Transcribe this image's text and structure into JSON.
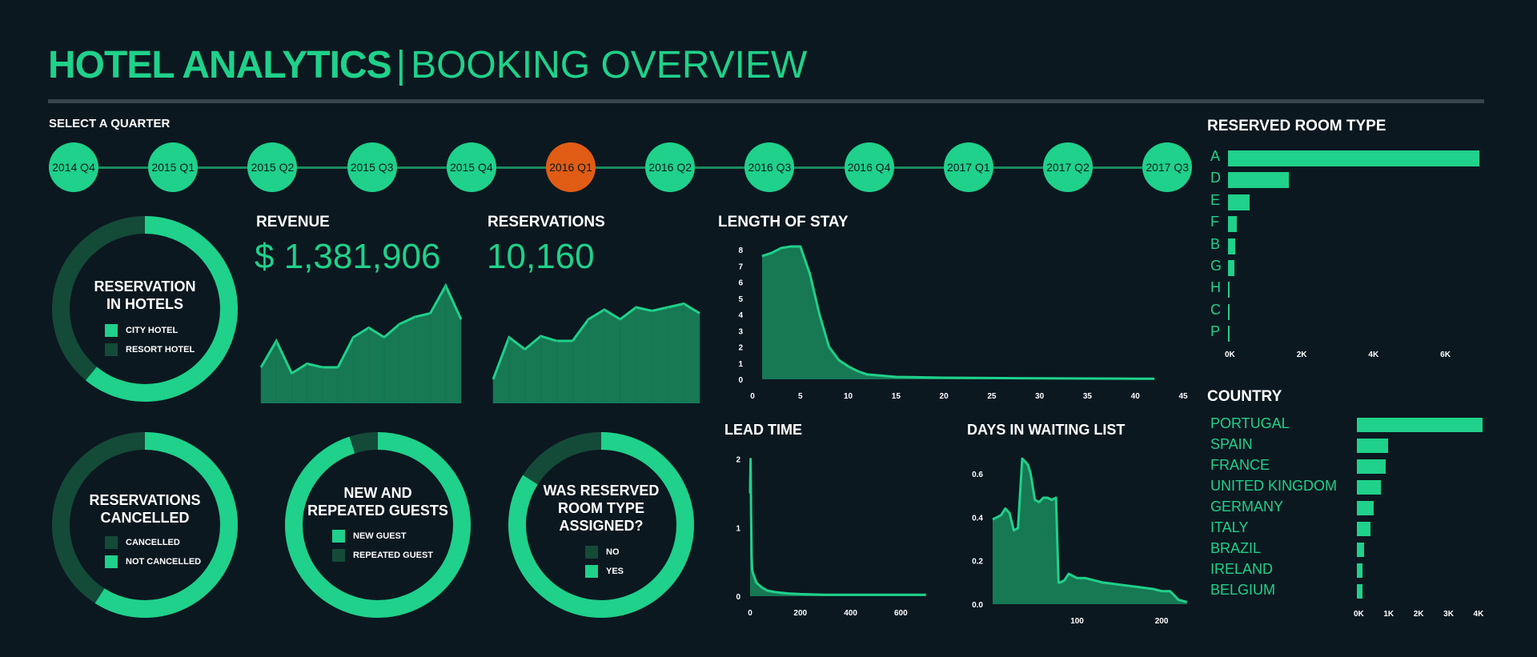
{
  "header": {
    "title_bold": "HOTEL ANALYTICS",
    "separator": "|",
    "title_thin": "BOOKING OVERVIEW"
  },
  "timeline": {
    "label": "SELECT A QUARTER",
    "quarters": [
      "2014 Q4",
      "2015 Q1",
      "2015 Q2",
      "2015 Q3",
      "2015 Q4",
      "2016 Q1",
      "2016 Q2",
      "2016 Q3",
      "2016 Q4",
      "2017 Q1",
      "2017 Q2",
      "2017 Q3"
    ],
    "selected": "2016 Q1"
  },
  "colors": {
    "bg": "#0c1820",
    "accent": "#1fd18a",
    "dark": "#144a38",
    "selected": "#e05c14"
  },
  "donuts": {
    "hotels": {
      "title_l1": "RESERVATION",
      "title_l2": "IN HOTELS",
      "legend": [
        "CITY HOTEL",
        "RESORT HOTEL"
      ],
      "fraction": 0.61
    },
    "cancelled": {
      "title_l1": "RESERVATIONS",
      "title_l2": "CANCELLED",
      "legend": [
        "CANCELLED",
        "NOT CANCELLED"
      ],
      "fraction": 0.59
    },
    "guests": {
      "title_l1": "NEW AND",
      "title_l2": "REPEATED GUESTS",
      "legend": [
        "NEW GUEST",
        "REPEATED GUEST"
      ],
      "fraction": 0.95
    },
    "room_assigned": {
      "title_l1": "WAS RESERVED",
      "title_l2": "ROOM TYPE",
      "title_l3": "ASSIGNED?",
      "legend": [
        "NO",
        "YES"
      ],
      "fraction": 0.84
    }
  },
  "kpis": {
    "revenue": {
      "label": "REVENUE",
      "value": "$ 1,381,906"
    },
    "reservations": {
      "label": "RESERVATIONS",
      "value": "10,160"
    }
  },
  "chart_data": [
    {
      "type": "area",
      "title": "REVENUE",
      "values": [
        30,
        52,
        25,
        33,
        30,
        30,
        55,
        63,
        55,
        66,
        72,
        75,
        98,
        70
      ]
    },
    {
      "type": "area",
      "title": "RESERVATIONS",
      "values": [
        20,
        55,
        45,
        56,
        52,
        52,
        70,
        78,
        70,
        80,
        77,
        80,
        83,
        75
      ]
    },
    {
      "type": "area",
      "title": "LENGTH OF STAY",
      "x": [
        1,
        2,
        3,
        4,
        5,
        6,
        7,
        8,
        9,
        10,
        11,
        12,
        15,
        20,
        25,
        30,
        35,
        40,
        42
      ],
      "y": [
        7.6,
        7.8,
        8.1,
        8.2,
        8.2,
        6.5,
        4,
        2,
        1.2,
        0.8,
        0.5,
        0.3,
        0.15,
        0.1,
        0.08,
        0.06,
        0.05,
        0.04,
        0.04
      ],
      "xticks": [
        0,
        5,
        10,
        15,
        20,
        25,
        30,
        35,
        40,
        45
      ],
      "yticks": [
        0,
        1,
        2,
        3,
        4,
        5,
        6,
        7,
        8
      ],
      "xlim": [
        0,
        45
      ],
      "ylim": [
        0,
        8
      ]
    },
    {
      "type": "area",
      "title": "LEAD TIME",
      "x": [
        0,
        2,
        4,
        6,
        8,
        10,
        15,
        20,
        25,
        30,
        40,
        50,
        70,
        100,
        150,
        200,
        300,
        400,
        500,
        600,
        700
      ],
      "y": [
        1.5,
        2.0,
        1.2,
        0.6,
        0.4,
        0.35,
        0.3,
        0.25,
        0.2,
        0.18,
        0.15,
        0.12,
        0.08,
        0.06,
        0.04,
        0.03,
        0.02,
        0.02,
        0.02,
        0.02,
        0.02
      ],
      "xticks": [
        0,
        200,
        400,
        600
      ],
      "yticks": [
        0,
        1,
        2
      ],
      "xlim": [
        0,
        720
      ],
      "ylim": [
        0,
        2.1
      ]
    },
    {
      "type": "area",
      "title": "DAYS IN WAITING LIST",
      "x": [
        0,
        5,
        10,
        15,
        20,
        25,
        30,
        35,
        40,
        42,
        45,
        50,
        55,
        60,
        65,
        70,
        75,
        78,
        80,
        85,
        90,
        100,
        110,
        120,
        130,
        150,
        170,
        190,
        200,
        210,
        220,
        230
      ],
      "y": [
        0.39,
        0.4,
        0.41,
        0.44,
        0.42,
        0.34,
        0.35,
        0.67,
        0.65,
        0.64,
        0.6,
        0.48,
        0.47,
        0.49,
        0.49,
        0.48,
        0.49,
        0.1,
        0.1,
        0.11,
        0.14,
        0.12,
        0.12,
        0.11,
        0.1,
        0.09,
        0.08,
        0.07,
        0.06,
        0.06,
        0.02,
        0.01
      ],
      "xticks": [
        100,
        200
      ],
      "yticks": [
        0.0,
        0.2,
        0.4,
        0.6
      ],
      "xlim": [
        0,
        235
      ],
      "ylim": [
        0,
        0.7
      ]
    },
    {
      "type": "bar",
      "title": "RESERVED ROOM TYPE",
      "orientation": "horizontal",
      "categories": [
        "A",
        "D",
        "E",
        "F",
        "B",
        "G",
        "H",
        "C",
        "P"
      ],
      "values": [
        7000,
        1700,
        600,
        250,
        200,
        180,
        50,
        30,
        20
      ],
      "xticks": [
        "0K",
        "2K",
        "4K",
        "6K"
      ],
      "xtick_values": [
        0,
        2000,
        4000,
        6000
      ],
      "xlim": [
        0,
        7000
      ]
    },
    {
      "type": "bar",
      "title": "COUNTRY",
      "orientation": "horizontal",
      "categories": [
        "PORTUGAL",
        "SPAIN",
        "FRANCE",
        "UNITED KINGDOM",
        "GERMANY",
        "ITALY",
        "BRAZIL",
        "IRELAND",
        "BELGIUM"
      ],
      "values": [
        4200,
        1050,
        950,
        800,
        550,
        450,
        250,
        200,
        180
      ],
      "xticks": [
        "0K",
        "1K",
        "2K",
        "3K",
        "4K"
      ],
      "xtick_values": [
        0,
        1000,
        2000,
        3000,
        4000
      ],
      "xlim": [
        0,
        4200
      ]
    }
  ]
}
